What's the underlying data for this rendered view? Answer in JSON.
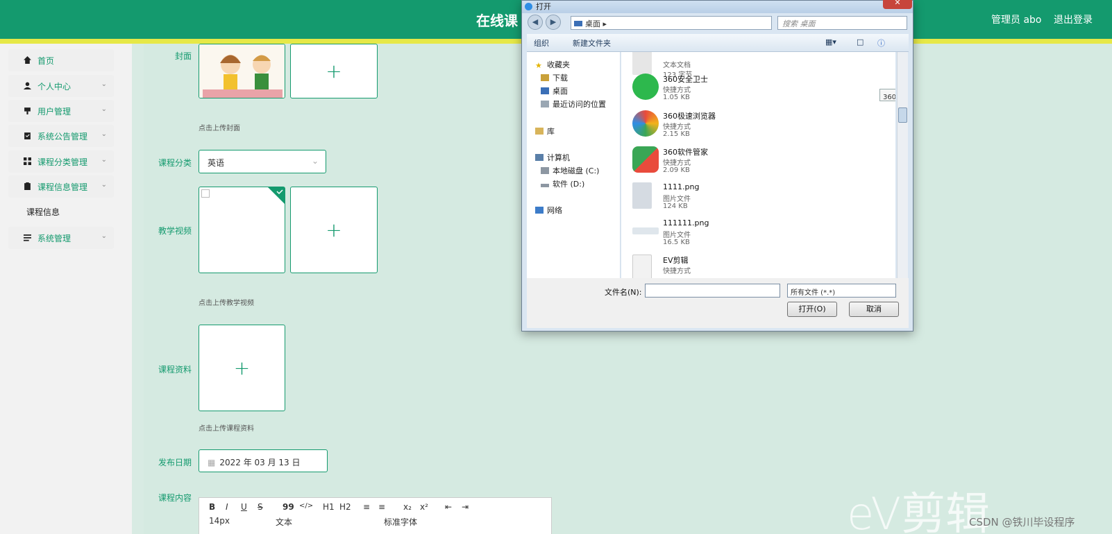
{
  "header": {
    "title": "在线课",
    "admin": "管理员 abo",
    "logout": "退出登录"
  },
  "sidebar": {
    "items": [
      {
        "label": "首页",
        "icon": "home-icon"
      },
      {
        "label": "个人中心",
        "icon": "user-icon"
      },
      {
        "label": "用户管理",
        "icon": "users-icon"
      },
      {
        "label": "系统公告管理",
        "icon": "clipboard-icon"
      },
      {
        "label": "课程分类管理",
        "icon": "grid-icon"
      },
      {
        "label": "课程信息管理",
        "icon": "clipboard-icon"
      },
      {
        "label": "系统管理",
        "icon": "list-icon"
      }
    ],
    "sub_item": "课程信息"
  },
  "form": {
    "cover_label": "封面",
    "cover_hint": "点击上传封面",
    "category_label": "课程分类",
    "category_value": "英语",
    "video_label": "教学视频",
    "video_hint": "点击上传教学视频",
    "material_label": "课程资料",
    "material_hint": "点击上传课程资料",
    "date_label": "发布日期",
    "date_value": "2022 年 03 月 13 日",
    "content_label": "课程内容",
    "editor_toolbar": [
      "B",
      "I",
      "U",
      "S",
      "99",
      "</>",
      "H1",
      "H2",
      "≡",
      "≡",
      "x₂",
      "x²",
      "⇤",
      "⇥"
    ],
    "editor_size": "14px",
    "editor_type": "文本",
    "editor_font": "标准字体"
  },
  "dialog": {
    "title": "打开",
    "address": "桌面",
    "search_placeholder": "搜索 桌面",
    "organize": "组织",
    "new_folder": "新建文件夹",
    "nav": {
      "favorites": "收藏夹",
      "downloads": "下载",
      "desktop": "桌面",
      "recent": "最近访问的位置",
      "library": "库",
      "computer": "计算机",
      "disk_c": "本地磁盘 (C:)",
      "disk_d": "软件 (D:)",
      "network": "网络"
    },
    "partial_top": {
      "type": "文本文档",
      "size": "123 字节"
    },
    "files": [
      {
        "name": "360安全卫士",
        "type": "快捷方式",
        "size": "1.05 KB",
        "color": "#2db84d"
      },
      {
        "name": "360极速浏览器",
        "type": "快捷方式",
        "size": "2.15 KB",
        "color": "#e94b3c"
      },
      {
        "name": "360软件管家",
        "type": "快捷方式",
        "size": "2.09 KB",
        "color": "#3aa655"
      },
      {
        "name": "1111.png",
        "type": "图片文件",
        "size": "124 KB",
        "color": "#cfd6dd"
      },
      {
        "name": "111111.png",
        "type": "图片文件",
        "size": "16.5 KB",
        "color": "#dfe6ec"
      },
      {
        "name": "EV剪辑",
        "type": "快捷方式",
        "size": "",
        "color": "#eeeeee"
      }
    ],
    "tooltip": "360安全卫士",
    "filename_label": "文件名(N):",
    "filetype": "所有文件 (*.*)",
    "open_btn": "打开(O)",
    "cancel_btn": "取消"
  },
  "watermark": "eV剪辑",
  "csdn": "CSDN @铁川毕设程序"
}
